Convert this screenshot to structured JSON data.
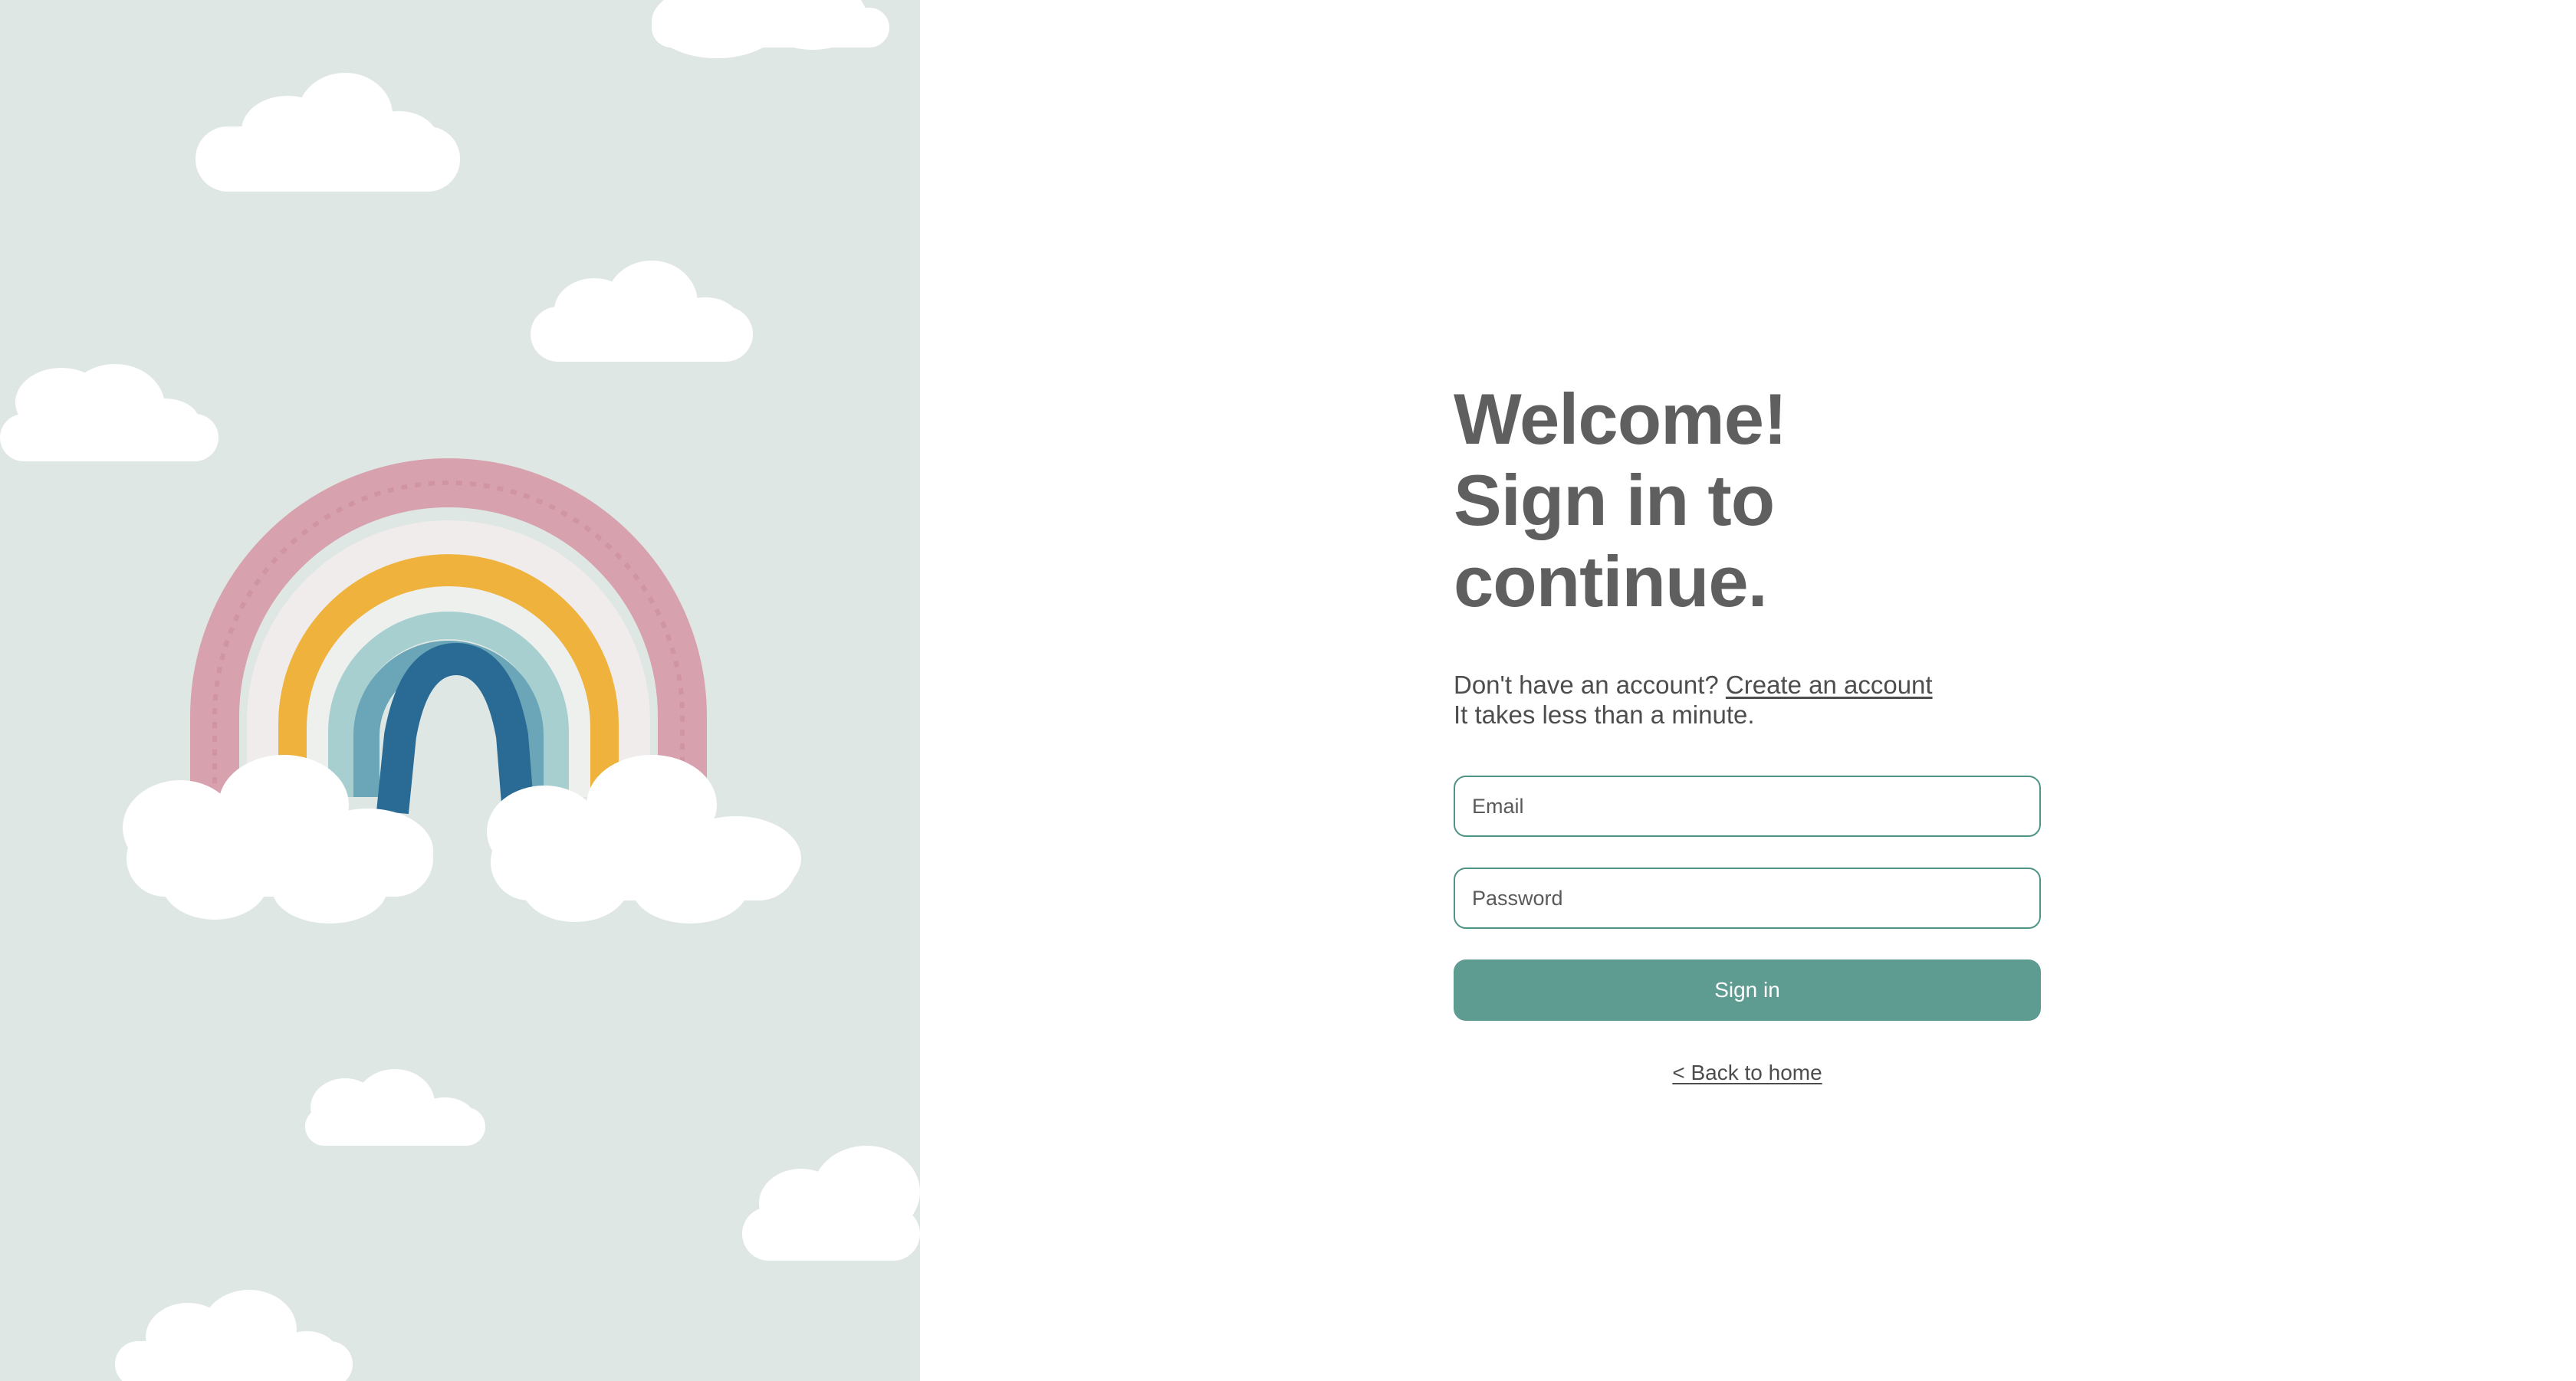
{
  "heading": {
    "line1": "Welcome!",
    "line2": "Sign in to continue."
  },
  "intro": {
    "prompt": "Don't have an account?",
    "create_link": "Create an account",
    "note": "It takes less than a minute."
  },
  "form": {
    "email_placeholder": "Email",
    "password_placeholder": "Password",
    "submit_label": "Sign in"
  },
  "back_link": "< Back to home",
  "hero": {
    "illustration": "rainbow-with-clouds",
    "background_color": "#dfe7e4"
  },
  "colors": {
    "accent": "#5e9c92",
    "border": "#4f9487",
    "text": "#5f5f5f"
  }
}
